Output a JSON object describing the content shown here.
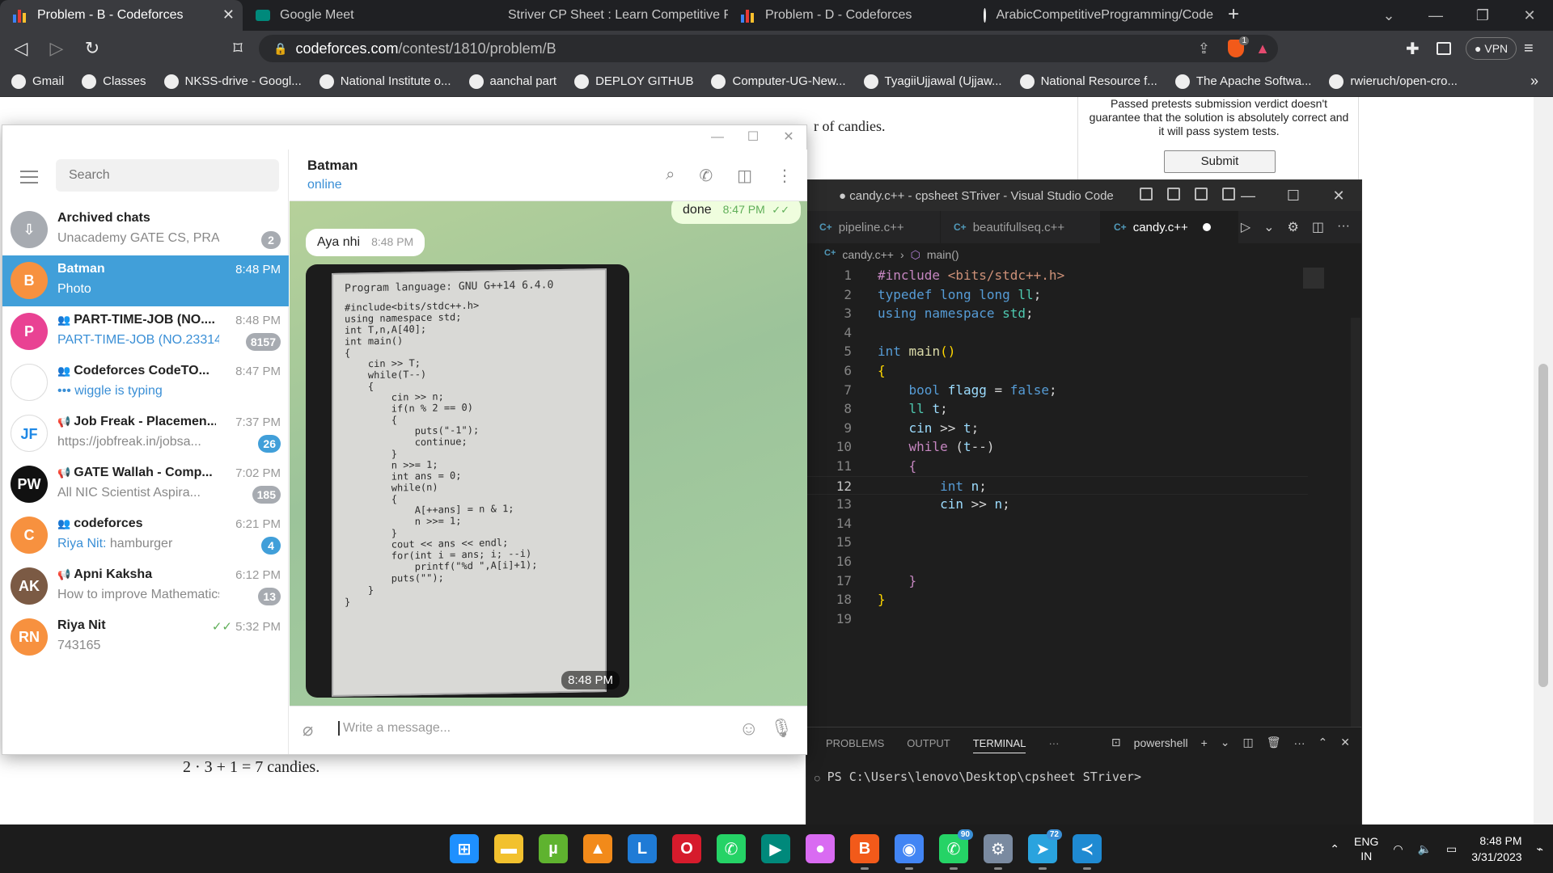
{
  "browser": {
    "tabs": [
      {
        "title": "Problem - B - Codeforces",
        "active": true
      },
      {
        "title": "Google Meet"
      },
      {
        "title": "Striver CP Sheet : Learn Competitive Pr"
      },
      {
        "title": "Problem - D - Codeforces"
      },
      {
        "title": "ArabicCompetitiveProgramming/Code"
      }
    ],
    "url_host": "codeforces.com",
    "url_path": "/contest/1810/problem/B",
    "vpn_label": "VPN",
    "brave_badge": "1",
    "bookmarks": [
      "Gmail",
      "Classes",
      "NKSS-drive - Googl...",
      "National Institute o...",
      "aanchal part",
      "DEPLOY GITHUB",
      "Computer-UG-New...",
      "TyagiiUjjawal (Ujjaw...",
      "National Resource f...",
      "The Apache Softwa...",
      "rwieruch/open-cro..."
    ]
  },
  "codeforces": {
    "text_fragment": "r of candies.",
    "sidebar_note": "Passed pretests submission verdict doesn't guarantee that the solution is absolutely correct and it will pass system tests.",
    "submit_label": "Submit",
    "formula": "2 · 3 + 1 = 7 candies."
  },
  "vscode": {
    "title": "● candy.c++ - cpsheet STriver - Visual Studio Code",
    "tabs": [
      {
        "label": "pipeline.c++"
      },
      {
        "label": "beautifullseq.c++"
      },
      {
        "label": "candy.c++",
        "active": true,
        "modified": true
      }
    ],
    "breadcrumb": {
      "file": "candy.c++",
      "symbol": "main()"
    },
    "current_line": 12,
    "panel_tabs": [
      "PROBLEMS",
      "OUTPUT",
      "TERMINAL"
    ],
    "active_panel": "TERMINAL",
    "shell_label": "powershell",
    "terminal_prompt": "PS C:\\Users\\lenovo\\Desktop\\cpsheet STriver>"
  },
  "telegram": {
    "search_placeholder": "Search",
    "chats": [
      {
        "name": "Archived chats",
        "preview": "Unacademy GATE CS, PRAYA...",
        "badge": "2",
        "avatar_color": "#a7abb1",
        "avatar_text": "⇩"
      },
      {
        "name": "Batman",
        "time": "8:48 PM",
        "preview": "Photo",
        "avatar_text": "B",
        "avatar_color": "#f7913f",
        "selected": true
      },
      {
        "name": "PART-TIME-JOB (NO....",
        "time": "8:48 PM",
        "preview": "PART-TIME-JOB (NO.23314...",
        "badge": "8157",
        "avatar_color": "#e94293",
        "avatar_text": "P",
        "group": true,
        "preview_blue": true
      },
      {
        "name": "Codeforces CodeTO...",
        "time": "8:47 PM",
        "preview": "••• wiggle is typing",
        "avatar_color": "#ffffff",
        "avatar_text": "",
        "group": true,
        "preview_blue": true
      },
      {
        "name": "Job Freak - Placemen...",
        "time": "7:37 PM",
        "preview": "https://jobfreak.in/jobsa...",
        "badge": "26",
        "avatar_color": "#ffffff",
        "avatar_text": "JF",
        "channel": true,
        "badge_blue": true
      },
      {
        "name": "GATE Wallah - Comp...",
        "time": "7:02 PM",
        "preview": "All NIC Scientist Aspira...",
        "badge": "185",
        "avatar_color": "#111111",
        "avatar_text": "PW",
        "channel": true
      },
      {
        "name": "codeforces",
        "time": "6:21 PM",
        "preview_sender": "Riya Nit:",
        "preview": "hamburger",
        "badge": "4",
        "avatar_color": "#f7913f",
        "avatar_text": "C",
        "group": true,
        "badge_blue": true
      },
      {
        "name": "Apni Kaksha",
        "time": "6:12 PM",
        "preview": "How to improve Mathematics",
        "badge": "13",
        "avatar_color": "#7b5a44",
        "avatar_text": "AK",
        "channel": true
      },
      {
        "name": "Riya Nit",
        "time": "5:32 PM",
        "preview": "743165",
        "avatar_color": "#f7913f",
        "avatar_text": "RN",
        "read": true
      }
    ],
    "peer_name": "Batman",
    "peer_status": "online",
    "messages": [
      {
        "text": "done",
        "time": "8:47 PM",
        "out": true
      },
      {
        "text": "Aya nhi",
        "time": "8:48 PM",
        "out": false
      }
    ],
    "photo_time": "8:48 PM",
    "photo_lang": "Program language: GNU G++14 6.4.0",
    "photo_code": "#include<bits/stdc++.h>\nusing namespace std;\nint T,n,A[40];\nint main()\n{\n    cin >> T;\n    while(T--)\n    {\n        cin >> n;\n        if(n % 2 == 0)\n        {\n            puts(\"-1\");\n            continue;\n        }\n        n >>= 1;\n        int ans = 0;\n        while(n)\n        {\n            A[++ans] = n & 1;\n            n >>= 1;\n        }\n        cout << ans << endl;\n        for(int i = ans; i; --i)\n            printf(\"%d \",A[i]+1);\n        puts(\"\");\n    }\n}",
    "input_placeholder": "Write a message..."
  },
  "taskbar": {
    "apps": [
      {
        "name": "start",
        "color": "#1e90ff",
        "glyph": "⊞"
      },
      {
        "name": "file-explorer",
        "color": "#f2c12e",
        "glyph": "▬"
      },
      {
        "name": "utorrent",
        "color": "#5fb32f",
        "glyph": "µ"
      },
      {
        "name": "vlc",
        "color": "#f28a1a",
        "glyph": "▲"
      },
      {
        "name": "libby",
        "color": "#1f7bd6",
        "glyph": "L"
      },
      {
        "name": "opera",
        "color": "#d61b2c",
        "glyph": "O"
      },
      {
        "name": "whatsapp-desktop",
        "color": "#25d366",
        "glyph": "✆"
      },
      {
        "name": "meet",
        "color": "#00897b",
        "glyph": "▶"
      },
      {
        "name": "app-pink",
        "color": "#d96bf2",
        "glyph": "●"
      },
      {
        "name": "brave",
        "color": "#f25a1a",
        "glyph": "B"
      },
      {
        "name": "chrome",
        "color": "#4285f4",
        "glyph": "◉"
      },
      {
        "name": "whatsapp",
        "color": "#25d366",
        "glyph": "✆",
        "notify": "90"
      },
      {
        "name": "settings",
        "color": "#7a8aa0",
        "glyph": "⚙"
      },
      {
        "name": "telegram",
        "color": "#2aa3de",
        "glyph": "➤",
        "notify": "72"
      },
      {
        "name": "vscode",
        "color": "#1f8ad2",
        "glyph": "≺"
      }
    ],
    "lang_line1": "ENG",
    "lang_line2": "IN",
    "time": "8:48 PM",
    "date": "3/31/2023"
  }
}
